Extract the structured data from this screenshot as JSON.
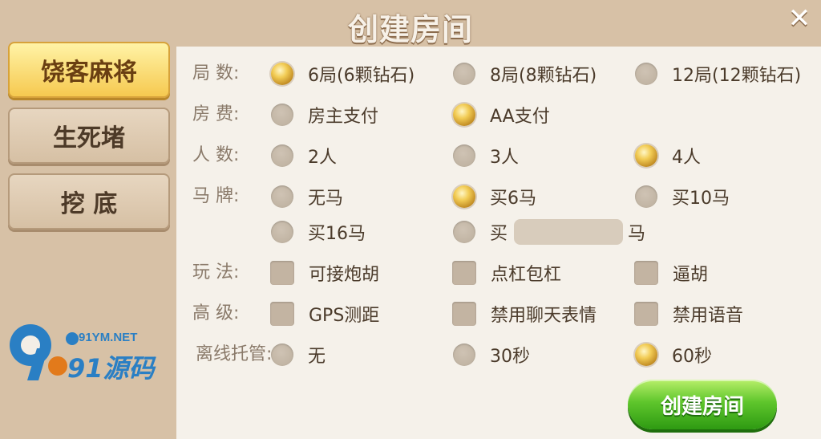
{
  "title": "创建房间",
  "close_symbol": "✕",
  "sidebar": {
    "items": [
      {
        "label": "饶客麻将",
        "active": true
      },
      {
        "label": "生死堵",
        "active": false
      },
      {
        "label": "挖  底",
        "active": false
      }
    ]
  },
  "rows": {
    "rounds": {
      "label": "局  数:",
      "options": [
        "6局(6颗钻石)",
        "8局(8颗钻石)",
        "12局(12颗钻石)"
      ],
      "selected": 0
    },
    "fee": {
      "label": "房  费:",
      "options": [
        "房主支付",
        "AA支付"
      ],
      "selected": 1
    },
    "players": {
      "label": "人  数:",
      "options": [
        "2人",
        "3人",
        "4人"
      ],
      "selected": 2
    },
    "horse": {
      "label": "马  牌:",
      "options": [
        "无马",
        "买6马",
        "买10马",
        "买16马"
      ],
      "buy_prefix": "买",
      "buy_suffix": "马",
      "selected": 1
    },
    "play": {
      "label": "玩  法:",
      "options": [
        "可接炮胡",
        "点杠包杠",
        "逼胡"
      ]
    },
    "advanced": {
      "label": "高  级:",
      "options": [
        "GPS测距",
        "禁用聊天表情",
        "禁用语音"
      ]
    },
    "offline": {
      "label": "离线托管:",
      "options": [
        "无",
        "30秒",
        "60秒"
      ],
      "selected": 2
    }
  },
  "create_button": "创建房间",
  "watermark": {
    "site": "91YM.NET",
    "brand": "91源码",
    "logo": "9"
  }
}
